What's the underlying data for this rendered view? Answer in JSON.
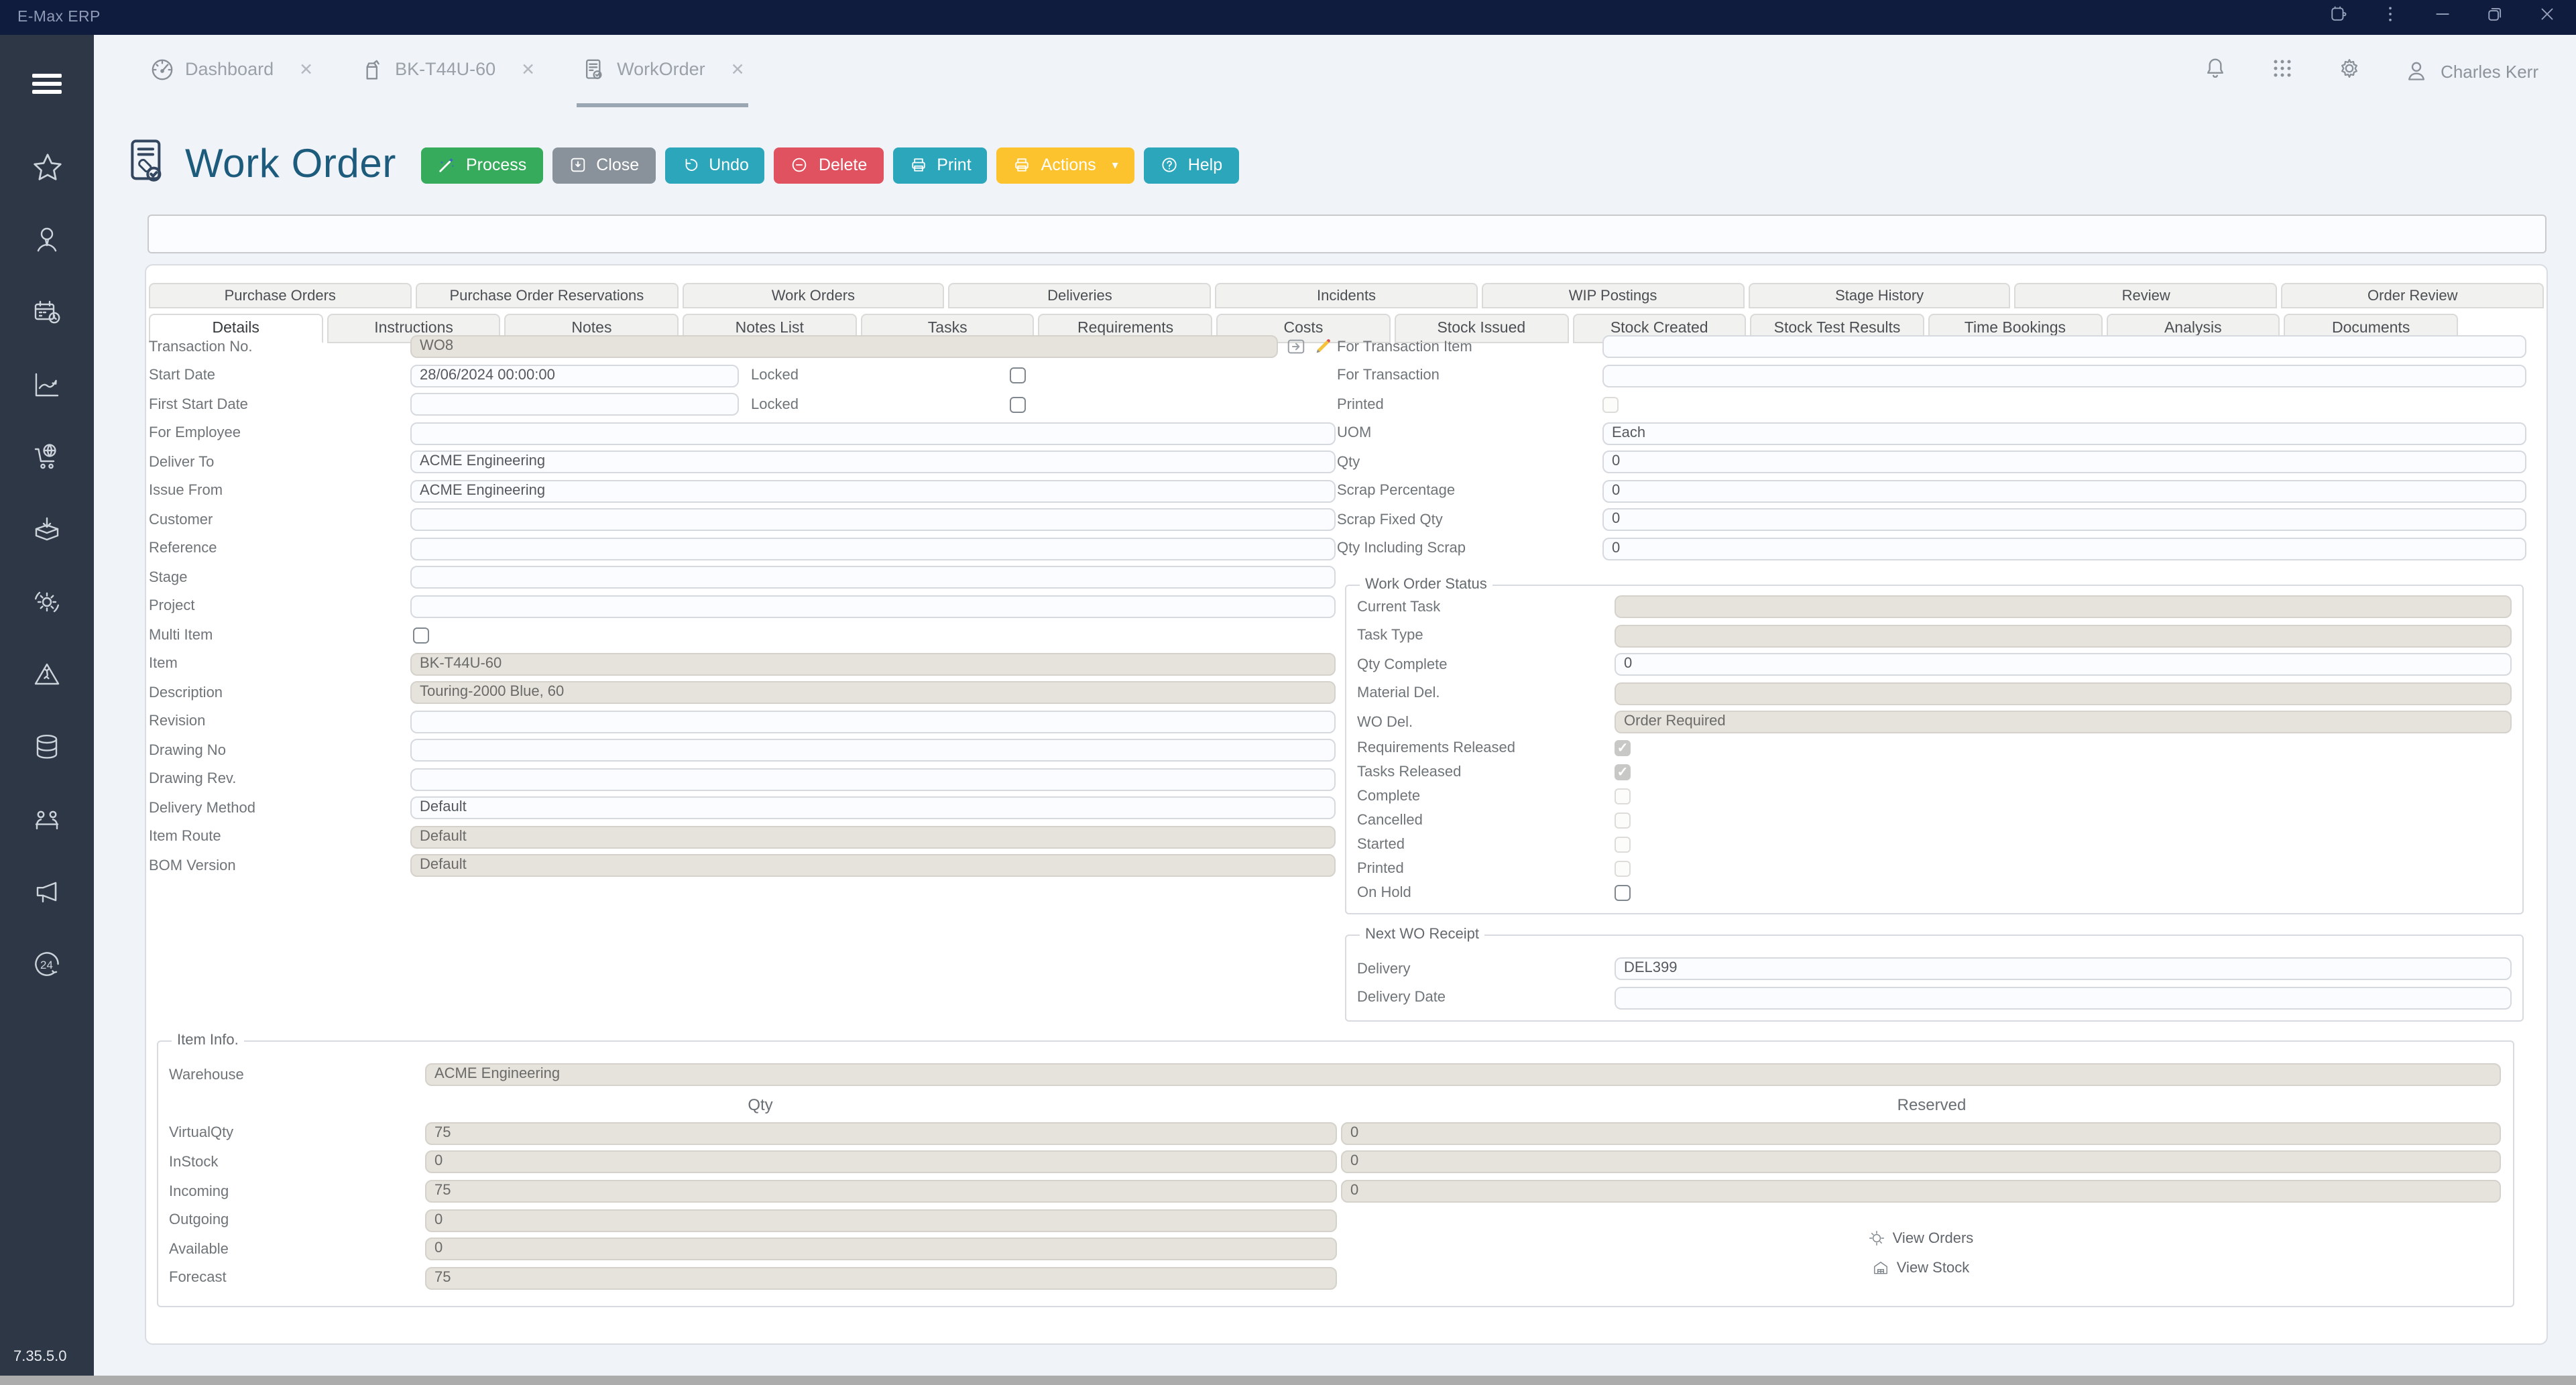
{
  "colors": {
    "titlebar": "#0f1c3e",
    "sidebar": "#2e3746",
    "accent_green": "#35ab5b",
    "accent_gray": "#89919a",
    "accent_teal": "#2ba6bb",
    "accent_red": "#e0525f",
    "accent_yellow": "#fdc32e",
    "tab_underline": "#9aa6b2",
    "title_text": "#1d5b7c"
  },
  "window": {
    "app_title": "E-Max ERP",
    "version": "7.35.5.0"
  },
  "header": {
    "close_glyph": "✕",
    "user": "Charles Kerr",
    "nav_tabs": [
      {
        "label": "Dashboard"
      },
      {
        "label": "BK-T44U-60"
      },
      {
        "label": "WorkOrder",
        "active": true
      }
    ]
  },
  "page": {
    "title": "Work Order"
  },
  "toolbar": {
    "buttons": [
      {
        "label": "Process",
        "color": "#35ab5b"
      },
      {
        "label": "Close",
        "color": "#89919a"
      },
      {
        "label": "Undo",
        "color": "#2ba6bb"
      },
      {
        "label": "Delete",
        "color": "#e0525f"
      },
      {
        "label": "Print",
        "color": "#2ba6bb"
      },
      {
        "label": "Actions",
        "color": "#fdc32e",
        "caret": "▾"
      },
      {
        "label": "Help",
        "color": "#2ba6bb"
      }
    ]
  },
  "outer_tabs": [
    {
      "label": "Purchase Orders"
    },
    {
      "label": "Purchase Order Reservations"
    },
    {
      "label": "Work Orders"
    },
    {
      "label": "Deliveries"
    },
    {
      "label": "Incidents"
    },
    {
      "label": "WIP Postings"
    },
    {
      "label": "Stage History"
    },
    {
      "label": "Review"
    },
    {
      "label": "Order Review"
    }
  ],
  "inner_tabs": [
    {
      "label": "Details",
      "cls": "active"
    },
    {
      "label": "Instructions"
    },
    {
      "label": "Notes"
    },
    {
      "label": "Notes List"
    },
    {
      "label": "Tasks"
    },
    {
      "label": "Requirements"
    },
    {
      "label": "Costs"
    },
    {
      "label": "Stock Issued"
    },
    {
      "label": "Stock Created"
    },
    {
      "label": "Stock Test Results"
    },
    {
      "label": "Time Bookings"
    },
    {
      "label": "Analysis"
    },
    {
      "label": "Documents"
    }
  ],
  "form": {
    "left": {
      "transaction": {
        "label": "Transaction No.",
        "value": "WO8"
      },
      "date_rows": [
        {
          "label": "Start Date",
          "value": "28/06/2024 00:00:00",
          "locked_label": "Locked"
        },
        {
          "label": "First Start Date",
          "value": "",
          "locked_label": "Locked"
        }
      ],
      "rows_a": [
        {
          "label": "For Employee",
          "value": "",
          "state": "en"
        },
        {
          "label": "Deliver To",
          "value": "ACME Engineering",
          "state": "en"
        },
        {
          "label": "Issue From",
          "value": "ACME Engineering",
          "state": "en"
        },
        {
          "label": "Customer",
          "value": "",
          "state": "en"
        },
        {
          "label": "Reference",
          "value": "",
          "state": "en"
        },
        {
          "label": "Stage",
          "value": "",
          "state": "en"
        },
        {
          "label": "Project",
          "value": "",
          "state": "en"
        }
      ],
      "multi_item_label": "Multi Item",
      "rows_b": [
        {
          "label": "Item",
          "value": "BK-T44U-60",
          "state": "dis"
        },
        {
          "label": "Description",
          "value": "Touring-2000 Blue, 60",
          "state": "dis"
        },
        {
          "label": "Revision",
          "value": "",
          "state": "en"
        },
        {
          "label": "Drawing No",
          "value": "",
          "state": "en"
        },
        {
          "label": "Drawing Rev.",
          "value": "",
          "state": "en"
        },
        {
          "label": "Delivery Method",
          "value": "Default",
          "state": "en"
        },
        {
          "label": "Item Route",
          "value": "Default",
          "state": "dis"
        },
        {
          "label": "BOM Version",
          "value": "Default",
          "state": "dis"
        }
      ]
    },
    "right": {
      "rows_a": [
        {
          "label": "For Transaction Item",
          "value": "",
          "state": "en"
        },
        {
          "label": "For Transaction",
          "value": "",
          "state": "en"
        }
      ],
      "printed_label": "Printed",
      "rows_b": [
        {
          "label": "UOM",
          "value": "Each",
          "state": "en"
        },
        {
          "label": "Qty",
          "value": "0",
          "state": "en"
        },
        {
          "label": "Scrap Percentage",
          "value": "0",
          "state": "en"
        },
        {
          "label": "Scrap Fixed Qty",
          "value": "0",
          "state": "en"
        },
        {
          "label": "Qty Including Scrap",
          "value": "0",
          "state": "en"
        }
      ]
    }
  },
  "status": {
    "legend": "Work Order Status",
    "rows": [
      {
        "label": "Current Task",
        "value": "",
        "state": "dis"
      },
      {
        "label": "Task Type",
        "value": "",
        "state": "dis"
      },
      {
        "label": "Qty Complete",
        "value": "0",
        "state": "en"
      },
      {
        "label": "Material Del.",
        "value": "",
        "state": "dis"
      },
      {
        "label": "WO Del.",
        "value": "Order Required",
        "state": "dis"
      }
    ],
    "checks": [
      {
        "label": "Requirements Released",
        "state": "ck-dis-checked"
      },
      {
        "label": "Tasks Released",
        "state": "ck-dis-checked"
      },
      {
        "label": "Complete",
        "state": "ck-dis"
      },
      {
        "label": "Cancelled",
        "state": "ck-dis"
      },
      {
        "label": "Started",
        "state": "ck-dis"
      },
      {
        "label": "Printed",
        "state": "ck-dis"
      },
      {
        "label": "On Hold",
        "state": "ck-en"
      }
    ]
  },
  "next_wo": {
    "legend": "Next WO Receipt",
    "rows": [
      {
        "label": "Delivery",
        "value": "DEL399",
        "state": "en"
      },
      {
        "label": "Delivery Date",
        "value": "",
        "state": "en"
      }
    ]
  },
  "item_info": {
    "legend": "Item Info.",
    "warehouse": {
      "label": "Warehouse",
      "value": "ACME Engineering"
    },
    "col_qty": "Qty",
    "col_reserved": "Reserved",
    "rows": [
      {
        "label": "VirtualQty",
        "qty": "75",
        "reserved": "0"
      },
      {
        "label": "InStock",
        "qty": "0",
        "reserved": "0"
      },
      {
        "label": "Incoming",
        "qty": "75",
        "reserved": "0"
      },
      {
        "label": "Outgoing",
        "qty": "0"
      },
      {
        "label": "Available",
        "qty": "0"
      },
      {
        "label": "Forecast",
        "qty": "75"
      }
    ],
    "links": [
      {
        "label": "View Orders"
      },
      {
        "label": "View Stock"
      }
    ]
  },
  "sidebar": {
    "icons": [
      "favorites",
      "hr",
      "scheduler",
      "analytics",
      "purchasing",
      "goods-in",
      "production",
      "incidents",
      "database",
      "meetings",
      "marketing",
      "support-24"
    ]
  }
}
